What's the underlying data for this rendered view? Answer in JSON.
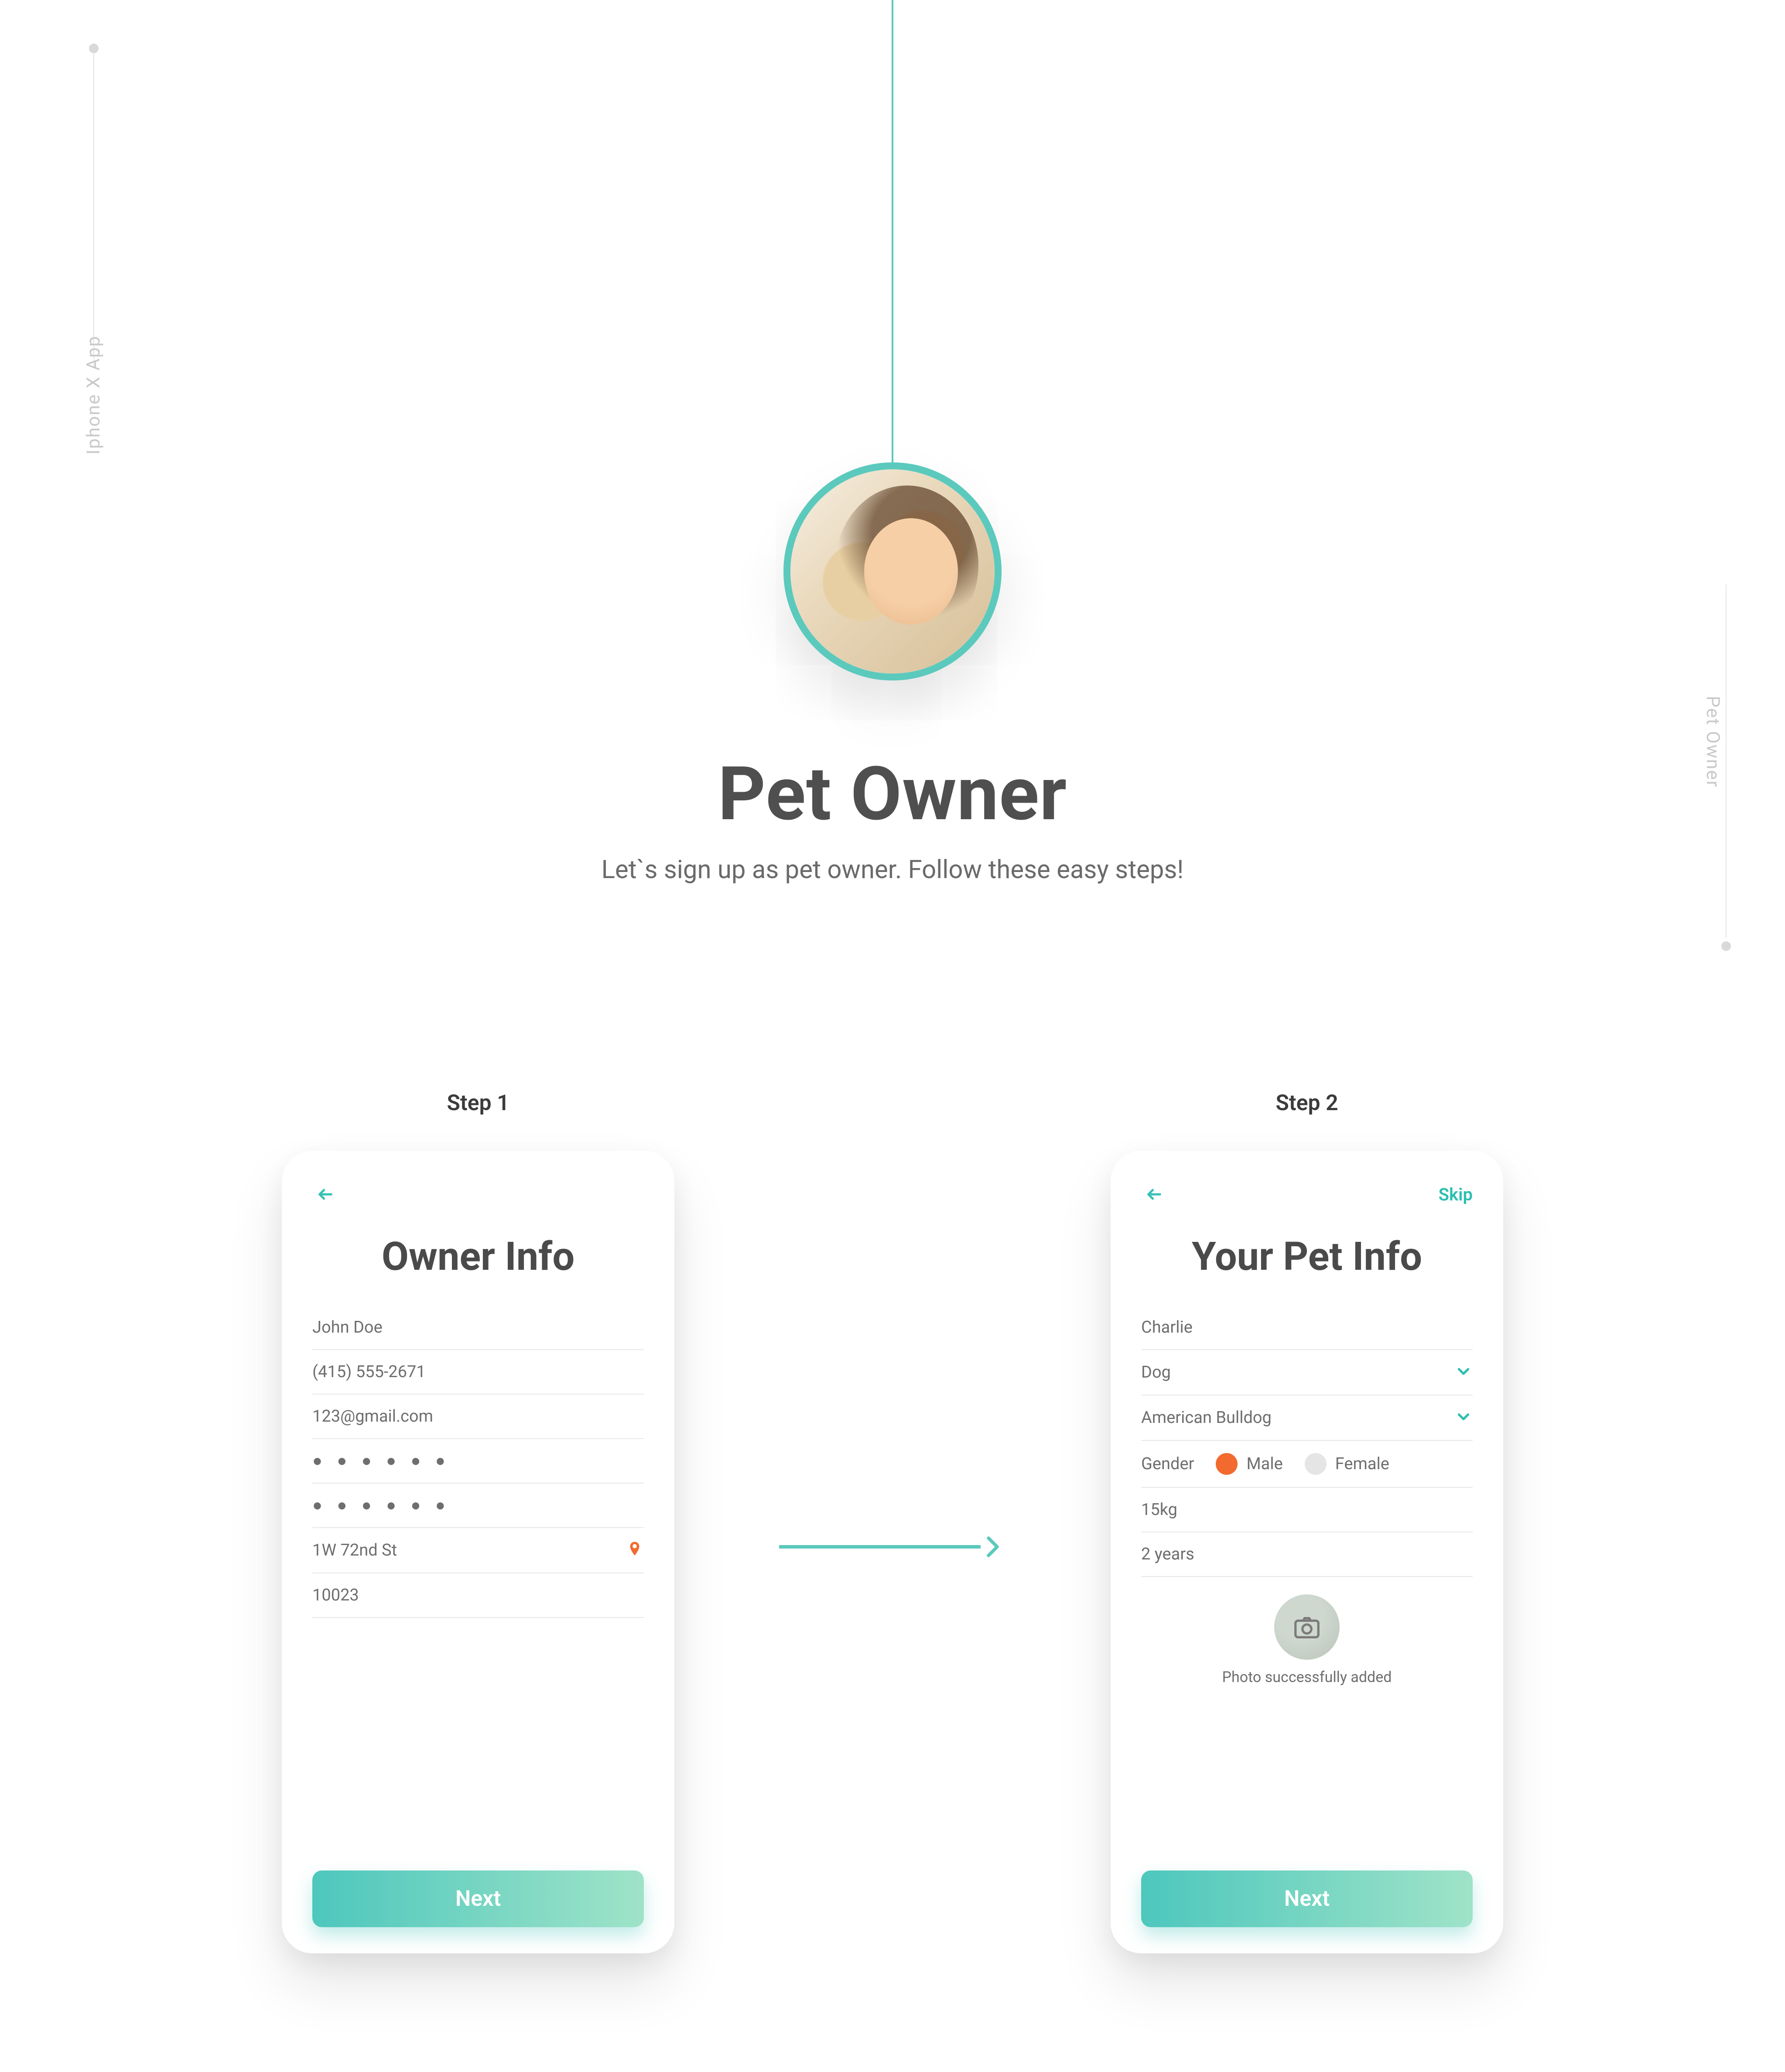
{
  "sidebar_left_label": "Iphone X App",
  "sidebar_right_label": "Pet Owner",
  "headline": {
    "title": "Pet Owner",
    "subtitle": "Let`s sign up as pet owner. Follow these easy steps!"
  },
  "steps": {
    "step1": {
      "label": "Step 1",
      "title": "Owner Info",
      "fields": {
        "name": "John Doe",
        "phone": "(415) 555-2671",
        "email": "123@gmail.com",
        "password1": "● ● ● ● ● ●",
        "password2": "● ● ● ● ● ●",
        "address": "1W 72nd St",
        "zip": "10023"
      },
      "next": "Next"
    },
    "step2": {
      "label": "Step 2",
      "skip": "Skip",
      "title": "Your Pet Info",
      "fields": {
        "petname": "Charlie",
        "species": "Dog",
        "breed": "American Bulldog",
        "gender_label": "Gender",
        "gender_male": "Male",
        "gender_female": "Female",
        "weight": "15kg",
        "age": "2 years",
        "photo_msg": "Photo successfully added"
      },
      "next": "Next"
    }
  }
}
